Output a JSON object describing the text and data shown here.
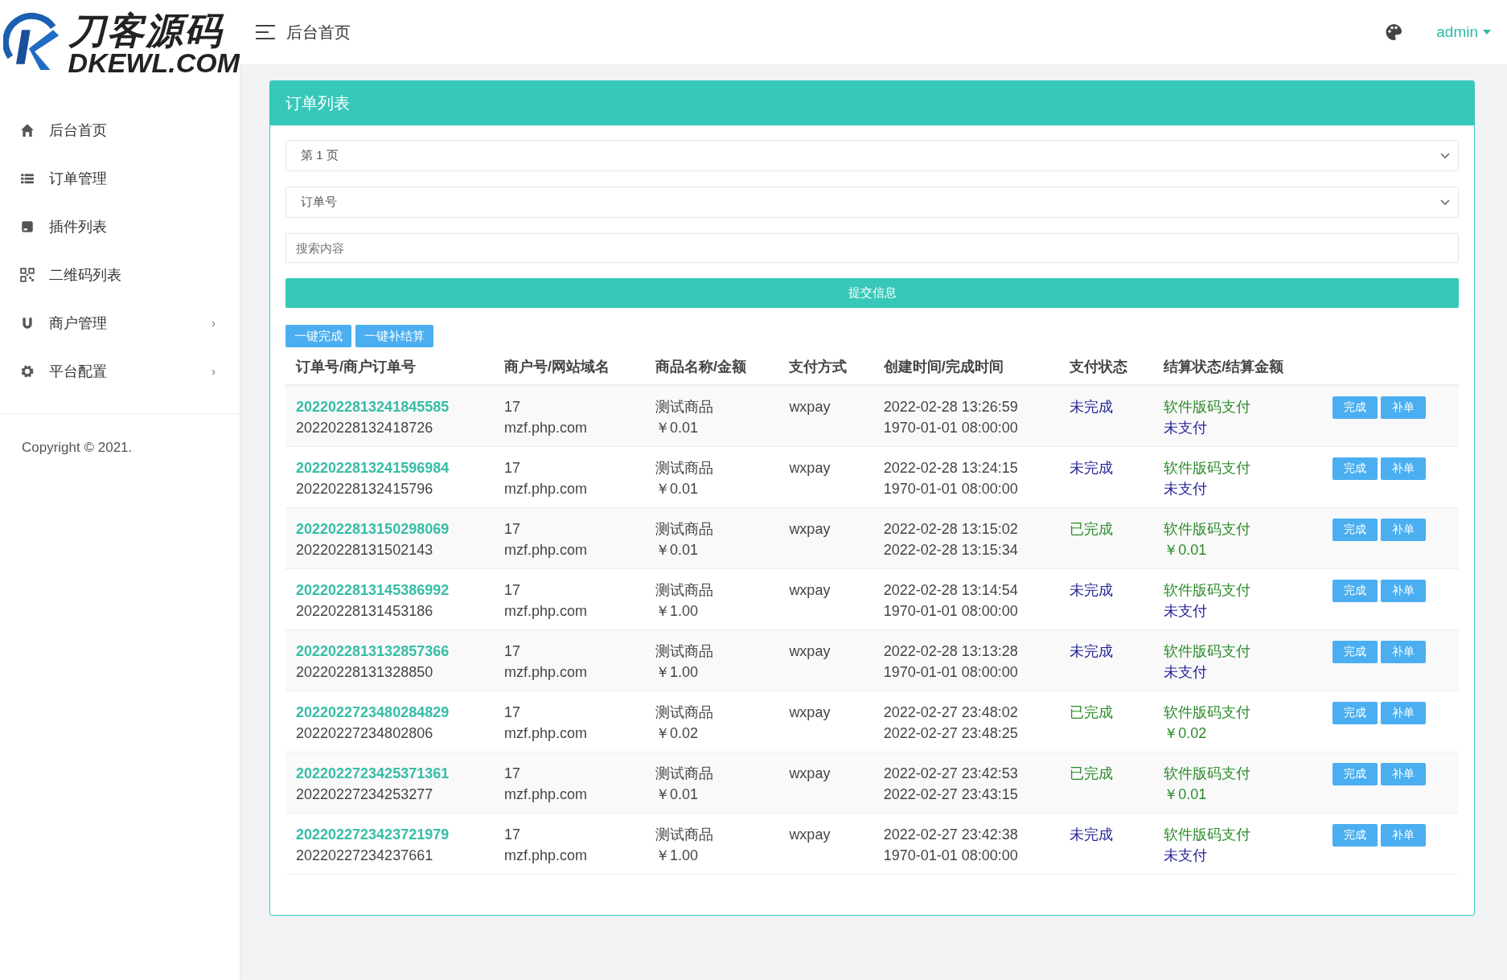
{
  "logo": {
    "title": "刀客源码",
    "subtitle": "DKEWL.COM"
  },
  "topbar": {
    "title": "后台首页",
    "user": "admin"
  },
  "sidebar": {
    "items": [
      {
        "label": "后台首页"
      },
      {
        "label": "订单管理"
      },
      {
        "label": "插件列表"
      },
      {
        "label": "二维码列表"
      },
      {
        "label": "商户管理",
        "arrow": "›"
      },
      {
        "label": "平台配置",
        "arrow": "›"
      }
    ],
    "copyright": "Copyright © 2021."
  },
  "panel": {
    "title": "订单列表",
    "page_select": {
      "value": "第 1 页"
    },
    "field_select": {
      "value": "订单号"
    },
    "search": {
      "placeholder": "搜索内容"
    },
    "submit": "提交信息",
    "bulk_buttons": [
      "一键完成",
      "一键补结算"
    ],
    "table": {
      "columns": [
        "订单号/商户订单号",
        "商户号/网站域名",
        "商品名称/金额",
        "支付方式",
        "创建时间/完成时间",
        "支付状态",
        "结算状态/结算金额"
      ],
      "rows": [
        {
          "order_no": "2022022813241845585",
          "merchant_order_no": "20220228132418726",
          "merchant_id": "17",
          "domain": "mzf.php.com",
          "product": "测试商品",
          "amount": "￥0.01",
          "pay_method": "wxpay",
          "created": "2022-02-28 13:26:59",
          "completed": "1970-01-01 08:00:00",
          "pay_status": "未完成",
          "paid": false,
          "settle_method": "软件版码支付",
          "settle_amount": "未支付",
          "settled": false,
          "actions": [
            "完成",
            "补单"
          ]
        },
        {
          "order_no": "2022022813241596984",
          "merchant_order_no": "20220228132415796",
          "merchant_id": "17",
          "domain": "mzf.php.com",
          "product": "测试商品",
          "amount": "￥0.01",
          "pay_method": "wxpay",
          "created": "2022-02-28 13:24:15",
          "completed": "1970-01-01 08:00:00",
          "pay_status": "未完成",
          "paid": false,
          "settle_method": "软件版码支付",
          "settle_amount": "未支付",
          "settled": false,
          "actions": [
            "完成",
            "补单"
          ]
        },
        {
          "order_no": "2022022813150298069",
          "merchant_order_no": "20220228131502143",
          "merchant_id": "17",
          "domain": "mzf.php.com",
          "product": "测试商品",
          "amount": "￥0.01",
          "pay_method": "wxpay",
          "created": "2022-02-28 13:15:02",
          "completed": "2022-02-28 13:15:34",
          "pay_status": "已完成",
          "paid": true,
          "settle_method": "软件版码支付",
          "settle_amount": "￥0.01",
          "settled": true,
          "actions": [
            "完成",
            "补单"
          ]
        },
        {
          "order_no": "2022022813145386992",
          "merchant_order_no": "20220228131453186",
          "merchant_id": "17",
          "domain": "mzf.php.com",
          "product": "测试商品",
          "amount": "￥1.00",
          "pay_method": "wxpay",
          "created": "2022-02-28 13:14:54",
          "completed": "1970-01-01 08:00:00",
          "pay_status": "未完成",
          "paid": false,
          "settle_method": "软件版码支付",
          "settle_amount": "未支付",
          "settled": false,
          "actions": [
            "完成",
            "补单"
          ]
        },
        {
          "order_no": "2022022813132857366",
          "merchant_order_no": "20220228131328850",
          "merchant_id": "17",
          "domain": "mzf.php.com",
          "product": "测试商品",
          "amount": "￥1.00",
          "pay_method": "wxpay",
          "created": "2022-02-28 13:13:28",
          "completed": "1970-01-01 08:00:00",
          "pay_status": "未完成",
          "paid": false,
          "settle_method": "软件版码支付",
          "settle_amount": "未支付",
          "settled": false,
          "actions": [
            "完成",
            "补单"
          ]
        },
        {
          "order_no": "2022022723480284829",
          "merchant_order_no": "20220227234802806",
          "merchant_id": "17",
          "domain": "mzf.php.com",
          "product": "测试商品",
          "amount": "￥0.02",
          "pay_method": "wxpay",
          "created": "2022-02-27 23:48:02",
          "completed": "2022-02-27 23:48:25",
          "pay_status": "已完成",
          "paid": true,
          "settle_method": "软件版码支付",
          "settle_amount": "￥0.02",
          "settled": true,
          "actions": [
            "完成",
            "补单"
          ]
        },
        {
          "order_no": "2022022723425371361",
          "merchant_order_no": "20220227234253277",
          "merchant_id": "17",
          "domain": "mzf.php.com",
          "product": "测试商品",
          "amount": "￥0.01",
          "pay_method": "wxpay",
          "created": "2022-02-27 23:42:53",
          "completed": "2022-02-27 23:43:15",
          "pay_status": "已完成",
          "paid": true,
          "settle_method": "软件版码支付",
          "settle_amount": "￥0.01",
          "settled": true,
          "actions": [
            "完成",
            "补单"
          ]
        },
        {
          "order_no": "2022022723423721979",
          "merchant_order_no": "20220227234237661",
          "merchant_id": "17",
          "domain": "mzf.php.com",
          "product": "测试商品",
          "amount": "￥1.00",
          "pay_method": "wxpay",
          "created": "2022-02-27 23:42:38",
          "completed": "1970-01-01 08:00:00",
          "pay_status": "未完成",
          "paid": false,
          "settle_method": "软件版码支付",
          "settle_amount": "未支付",
          "settled": false,
          "actions": [
            "完成",
            "补单"
          ]
        }
      ]
    }
  }
}
